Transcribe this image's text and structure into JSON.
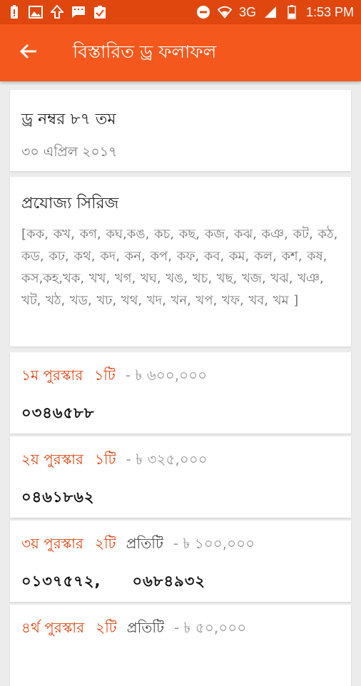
{
  "status_bar": {
    "network": "3G",
    "time": "1:53 PM",
    "icons": [
      "battery-alert-icon",
      "image-icon",
      "upload-icon",
      "message-icon",
      "clipboard-check-icon",
      "do-not-disturb-icon",
      "wifi-icon",
      "signal-icon",
      "battery-icon"
    ]
  },
  "appbar": {
    "title": "বিস্তারিত ড্র ফলাফল",
    "back_icon": "back-arrow-icon"
  },
  "draw": {
    "number": "ড্র নম্বর  ৮৭ তম",
    "date": "৩০ এপ্রিল ২০১৭"
  },
  "series": {
    "title": "প্রযোজ্য সিরিজ",
    "list": "[কক, কখ, কগ, কঘ,কঙ, কচ, কছ, কজ, কঝ, কঞ, কট, কঠ, কড, কঢ, কথ, কদ, কন, কপ, কফ, কব, কম, কল, কশ, কষ, কস,কহ,খক, খখ, খগ, খঘ, খঙ, খচ, খছ, খজ, খঝ, খঞ, খট, খঠ, খড, খঢ, খথ, খদ, খন,  খপ,  খফ,  খব, খম ]"
  },
  "prizes": [
    {
      "name": "১ম পুরস্কার",
      "count": "১টি",
      "each": "",
      "amount": "- ৳ ৬০০,০০০",
      "numbers": [
        "০৩৪৬৫৮৮"
      ]
    },
    {
      "name": "২য় পুরস্কার",
      "count": "১টি",
      "each": "",
      "amount": "- ৳ ৩২৫,০০০",
      "numbers": [
        "০৪৬১৮৬২"
      ]
    },
    {
      "name": "৩য় পুরস্কার",
      "count": "২টি",
      "each": "প্রতিটি",
      "amount": "- ৳ ১০০,০০০",
      "numbers": [
        "০১৩৭৫৭২,",
        "০৬৮৪৯৩২"
      ]
    },
    {
      "name": "৪র্থ পুরস্কার",
      "count": "২টি",
      "each": "প্রতিটি",
      "amount": "- ৳ ৫০,০০০",
      "numbers": []
    }
  ],
  "colors": {
    "status_bar": "#e0470f",
    "app_bar": "#f4581c",
    "prize_accent": "#e0450f",
    "background": "#ececec"
  }
}
